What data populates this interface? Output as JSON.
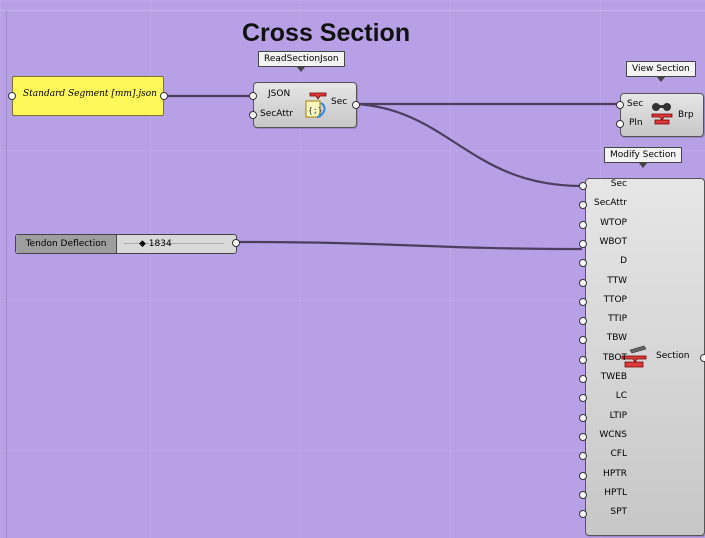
{
  "title": "Cross Section",
  "panel": {
    "text": "Standard Segment [mm].json"
  },
  "read_section": {
    "tag": "ReadSectionJson",
    "inputs": [
      "JSON",
      "SecAttr"
    ],
    "output": "Sec"
  },
  "view_section": {
    "tag": "View Section",
    "inputs": [
      "Sec",
      "Pln"
    ],
    "output": "Brp"
  },
  "modify_section": {
    "tag": "Modify Section",
    "inputs": [
      "Sec",
      "SecAttr",
      "WTOP",
      "WBOT",
      "D",
      "TTW",
      "TTOP",
      "TTIP",
      "TBW",
      "TBOT",
      "TWEB",
      "LC",
      "LTIP",
      "WCNS",
      "CFL",
      "HPTR",
      "HPTL",
      "SPT"
    ],
    "output": "Section"
  },
  "slider": {
    "name": "Tendon Deflection",
    "value": "1834"
  },
  "icons": [
    "json-reader-icon",
    "binoculars-icon",
    "section-icon"
  ],
  "colors": {
    "canvas": "#b7a0e6",
    "panel": "#fff85a",
    "wire": "#4a3f5e"
  }
}
